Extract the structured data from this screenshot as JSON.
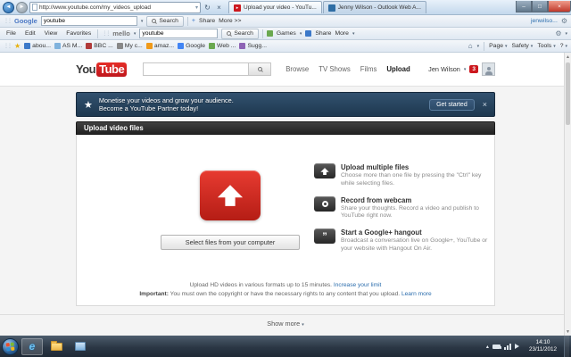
{
  "browser": {
    "url": "http://www.youtube.com/my_videos_upload",
    "tabs": [
      {
        "title": "Upload your video - YouTu..."
      },
      {
        "title": "Jenny Wilson - Outlook Web A..."
      }
    ],
    "menus": [
      "File",
      "Edit",
      "View",
      "Favorites"
    ],
    "google_toolbar": {
      "brand": "Google",
      "search_value": "youtube",
      "search_label": "Search",
      "share_label": "Share",
      "more_label": "More >>",
      "account": "jenwilso..."
    },
    "second_toolbar": {
      "brand": "mello",
      "search_value": "youtube",
      "search_label": "Search",
      "games_label": "Games",
      "share_label": "Share",
      "more_label": "More"
    },
    "favorites": [
      "abou...",
      "AS M...",
      "BBC ...",
      "My c...",
      "amaz...",
      "Google",
      "Web ...",
      "Sugg..."
    ],
    "command_bar": {
      "page": "Page",
      "safety": "Safety",
      "tools": "Tools",
      "help": "?"
    }
  },
  "youtube": {
    "logo_you": "You",
    "logo_tube": "Tube",
    "nav": [
      "Browse",
      "TV Shows",
      "Films",
      "Upload"
    ],
    "user": {
      "name": "Jen Wilson",
      "badge": "3"
    },
    "banner": {
      "line1": "Monetise your videos and grow your audience.",
      "line2": "Become a YouTube Partner today!",
      "button": "Get started"
    },
    "section_title": "Upload video files",
    "select_button": "Select files from your computer",
    "options": [
      {
        "title": "Upload multiple files",
        "desc": "Choose more than one file by pressing the \"Ctrl\" key while selecting files."
      },
      {
        "title": "Record from webcam",
        "desc": "Share your thoughts. Record a video and publish to YouTube right now."
      },
      {
        "title": "Start a Google+ hangout",
        "desc": "Broadcast a conversation live on Google+, YouTube or your website with Hangout On Air."
      }
    ],
    "footnote1": {
      "text": "Upload HD videos in various formats up to 15 minutes.",
      "link": "Increase your limit"
    },
    "footnote2": {
      "prefix": "Important:",
      "text": " You must own the copyright or have the necessary rights to any content that you upload. ",
      "link": "Learn more"
    },
    "show_more": "Show more"
  },
  "taskbar": {
    "time": "14:10",
    "date": "23/11/2012"
  },
  "icons": {
    "back": "◄",
    "forward": "►",
    "refresh": "↻",
    "stop": "×",
    "caret": "▾",
    "minimize": "–",
    "maximize": "□",
    "close": "×",
    "star": "★",
    "grip": "⋮⋮",
    "home": "⌂",
    "gear": "⚙",
    "plus": "+",
    "tab_play": "▸",
    "ie": "e",
    "scroll_up": "▲",
    "scroll_down": "▼",
    "tray_expand": "▴"
  },
  "colors": {
    "youtube_red": "#cc181e",
    "banner_blue": "#27486a",
    "link_blue": "#2b6dad",
    "taskbar_dark": "#2b3745"
  }
}
